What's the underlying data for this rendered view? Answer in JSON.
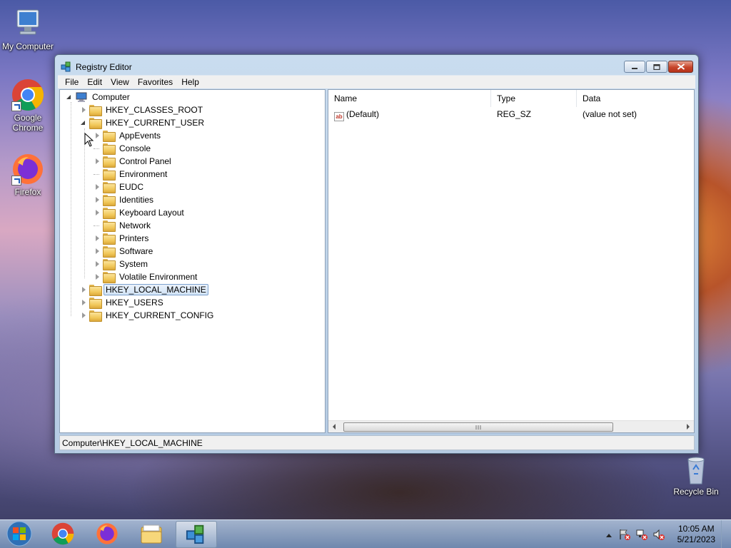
{
  "desktop": {
    "icons": [
      {
        "label": "My Computer"
      },
      {
        "label": "Google Chrome"
      },
      {
        "label": "Firefox"
      },
      {
        "label": "Recycle Bin"
      }
    ]
  },
  "window": {
    "title": "Registry Editor",
    "menu": [
      "File",
      "Edit",
      "View",
      "Favorites",
      "Help"
    ],
    "tree": {
      "root": "Computer",
      "hives": [
        {
          "label": "HKEY_CLASSES_ROOT"
        },
        {
          "label": "HKEY_CURRENT_USER"
        },
        {
          "label": "HKEY_LOCAL_MACHINE"
        },
        {
          "label": "HKEY_USERS"
        },
        {
          "label": "HKEY_CURRENT_CONFIG"
        }
      ],
      "current_user_children": [
        "AppEvents",
        "Console",
        "Control Panel",
        "Environment",
        "EUDC",
        "Identities",
        "Keyboard Layout",
        "Network",
        "Printers",
        "Software",
        "System",
        "Volatile Environment"
      ],
      "selected": "HKEY_LOCAL_MACHINE"
    },
    "list": {
      "columns": [
        "Name",
        "Type",
        "Data"
      ],
      "rows": [
        {
          "icon": "ab",
          "name": "(Default)",
          "type": "REG_SZ",
          "data": "(value not set)"
        }
      ]
    },
    "status_path": "Computer\\HKEY_LOCAL_MACHINE"
  },
  "taskbar": {
    "time": "10:05 AM",
    "date": "5/21/2023"
  }
}
